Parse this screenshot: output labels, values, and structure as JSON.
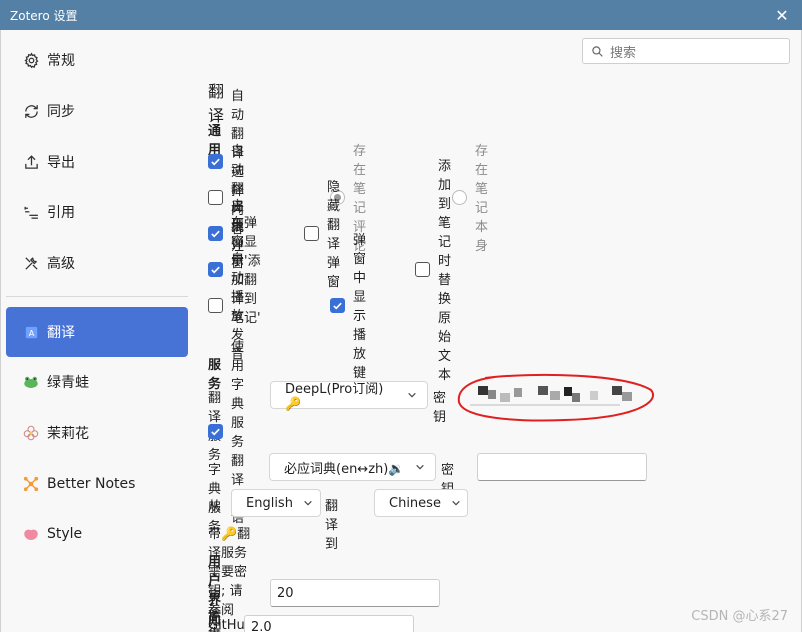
{
  "window": {
    "title": "Zotero 设置"
  },
  "search": {
    "placeholder": "搜索"
  },
  "sidebar": {
    "items": [
      {
        "label": "常规",
        "icon": "gear-icon"
      },
      {
        "label": "同步",
        "icon": "sync-icon"
      },
      {
        "label": "导出",
        "icon": "export-icon"
      },
      {
        "label": "引用",
        "icon": "cite-icon"
      },
      {
        "label": "高级",
        "icon": "tools-icon"
      },
      {
        "label": "翻译",
        "icon": "translate-icon",
        "active": true
      },
      {
        "label": "绿青蛙",
        "icon": "frog-icon"
      },
      {
        "label": "茉莉花",
        "icon": "jasmine-icon"
      },
      {
        "label": "Better Notes",
        "icon": "better-notes-icon"
      },
      {
        "label": "Style",
        "icon": "style-icon"
      }
    ]
  },
  "main": {
    "title": "翻译",
    "general": {
      "heading": "通用",
      "auto_translate_selection": "自动翻译选择内容",
      "auto_translate_annotation": "自动翻译批注",
      "save_to_note_comment": "存在笔记评论",
      "save_to_note_body": "存在笔记本身",
      "enable_popup": "启用弹窗",
      "hide_popup": "隐藏翻译弹窗",
      "show_add_to_note": "在弹窗显示'添加翻译到笔记'",
      "replace_original": "添加到笔记时替换原始文本",
      "auto_play_audio": "自动播放发音",
      "show_play_button": "弹窗中显示播放键"
    },
    "service": {
      "heading": "服务",
      "translate_service_label": "翻译服务",
      "translate_service_value": "DeepL(Pro订阅)🔑",
      "key_label": "密钥",
      "use_dictionary": "使用字典服务翻译词语",
      "dict_service_label": "字典服务",
      "dict_service_value": "必应词典(en↔zh)🔉",
      "dict_key_label": "密钥",
      "from_label": "从",
      "from_value": "English",
      "to_label": "翻译到",
      "to_value": "Chinese",
      "note": "带🔑翻译服务需要密钥; 请参阅GitHub"
    },
    "ui": {
      "heading": "用户界面",
      "font_size_label": "字体大小",
      "font_size_value": "20",
      "line_height_label": "行高",
      "line_height_value": "2.0"
    }
  },
  "watermark": "CSDN @心系27",
  "colors": {
    "titlebar": "#5480a6",
    "accent": "#4772d6",
    "checkbox": "#3a6fd6",
    "annotation": "#e02020"
  }
}
